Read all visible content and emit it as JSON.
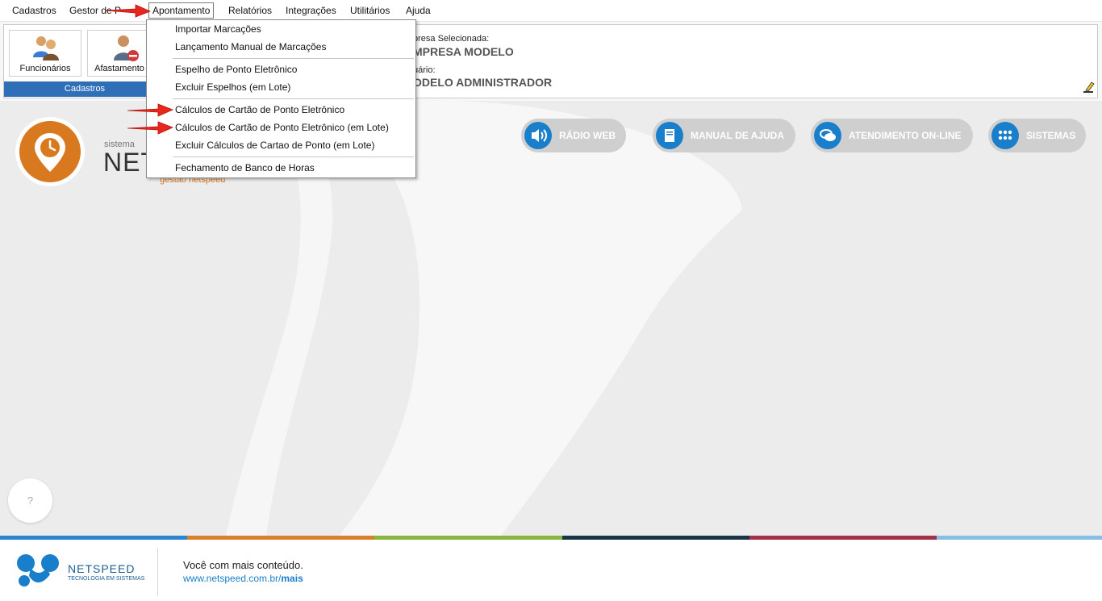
{
  "menubar": {
    "items": [
      "Cadastros",
      "Gestor de P",
      "Apontamento",
      "Relatórios",
      "Integrações",
      "Utilitários",
      "Ajuda"
    ]
  },
  "ribbon": {
    "buttons": [
      "Funcionários",
      "Afastamento"
    ],
    "group_label": "Cadastros",
    "company_label": "presa Selecionada:",
    "company_name": "MPRESA MODELO",
    "user_label": "uário:",
    "user_name": "ODELO ADMINISTRADOR"
  },
  "dropdown": {
    "items": [
      "Importar Marcações",
      "Lançamento Manual de Marcações",
      "Espelho de Ponto Eletrônico",
      "Excluir Espelhos (em Lote)",
      "Cálculos de Cartão de Ponto Eletrônico",
      "Cálculos de Cartão de Ponto Eletrônico (em Lote)",
      "Excluir Cálculos de Cartao de Ponto (em Lote)",
      "Fechamento de Banco de Horas"
    ]
  },
  "logo": {
    "small_text": "sistema",
    "big_text": "NET",
    "sub_text": "gestão netspeed"
  },
  "quick_links": [
    "RÁDIO WEB",
    "MANUAL DE AJUDA",
    "ATENDIMENTO ON-LINE",
    "SISTEMAS"
  ],
  "help_button": "?",
  "footer": {
    "brand": "NETSPEED",
    "brand_tagline": "TECNOLOGIA EM SISTEMAS",
    "slogan": "Você com mais conteúdo.",
    "url_prefix": "www.netspeed.com.br/",
    "url_bold": "mais"
  },
  "colors": {
    "accent_blue": "#1a7fcb",
    "ribbon_blue": "#2f6fb8",
    "logo_orange": "#d9791f",
    "arrow_red": "#e8261d",
    "stripe": [
      "#2a86cf",
      "#d77f2a",
      "#8ab53e",
      "#1b3446",
      "#a2324a",
      "#86bfe6"
    ]
  }
}
